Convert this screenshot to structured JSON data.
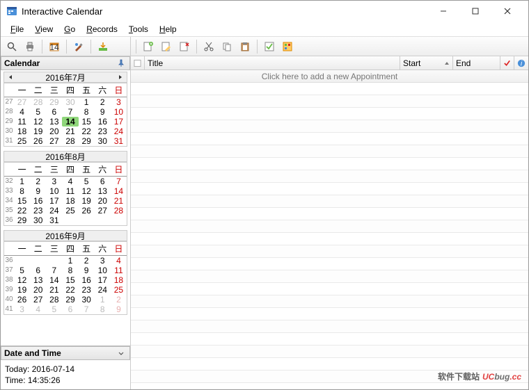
{
  "window": {
    "title": "Interactive Calendar"
  },
  "menu": {
    "file": "File",
    "view": "View",
    "go": "Go",
    "records": "Records",
    "tools": "Tools",
    "help": "Help"
  },
  "sidebar": {
    "calendar_label": "Calendar",
    "datetime_label": "Date and Time",
    "today_label": "Today: 2016-07-14",
    "time_label": "Time: 14:35:26"
  },
  "dow": [
    "一",
    "二",
    "三",
    "四",
    "五",
    "六",
    "日"
  ],
  "months": [
    {
      "title": "2016年7月",
      "nav": true,
      "weeks": [
        {
          "wk": 27,
          "days": [
            {
              "n": 27,
              "o": 1
            },
            {
              "n": 28,
              "o": 1
            },
            {
              "n": 29,
              "o": 1
            },
            {
              "n": 30,
              "o": 1
            },
            {
              "n": 1
            },
            {
              "n": 2
            },
            {
              "n": 3,
              "s": 1
            }
          ]
        },
        {
          "wk": 28,
          "days": [
            {
              "n": 4
            },
            {
              "n": 5
            },
            {
              "n": 6
            },
            {
              "n": 7
            },
            {
              "n": 8
            },
            {
              "n": 9
            },
            {
              "n": 10,
              "s": 1
            }
          ]
        },
        {
          "wk": 29,
          "days": [
            {
              "n": 11
            },
            {
              "n": 12
            },
            {
              "n": 13
            },
            {
              "n": 14,
              "t": 1
            },
            {
              "n": 15
            },
            {
              "n": 16
            },
            {
              "n": 17,
              "s": 1
            }
          ]
        },
        {
          "wk": 30,
          "days": [
            {
              "n": 18
            },
            {
              "n": 19
            },
            {
              "n": 20
            },
            {
              "n": 21
            },
            {
              "n": 22
            },
            {
              "n": 23
            },
            {
              "n": 24,
              "s": 1
            }
          ]
        },
        {
          "wk": 31,
          "days": [
            {
              "n": 25
            },
            {
              "n": 26
            },
            {
              "n": 27
            },
            {
              "n": 28
            },
            {
              "n": 29
            },
            {
              "n": 30
            },
            {
              "n": 31,
              "s": 1
            }
          ]
        }
      ]
    },
    {
      "title": "2016年8月",
      "nav": false,
      "weeks": [
        {
          "wk": 32,
          "days": [
            {
              "n": 1
            },
            {
              "n": 2
            },
            {
              "n": 3
            },
            {
              "n": 4
            },
            {
              "n": 5
            },
            {
              "n": 6
            },
            {
              "n": 7,
              "s": 1
            }
          ]
        },
        {
          "wk": 33,
          "days": [
            {
              "n": 8
            },
            {
              "n": 9
            },
            {
              "n": 10
            },
            {
              "n": 11
            },
            {
              "n": 12
            },
            {
              "n": 13
            },
            {
              "n": 14,
              "s": 1
            }
          ]
        },
        {
          "wk": 34,
          "days": [
            {
              "n": 15
            },
            {
              "n": 16
            },
            {
              "n": 17
            },
            {
              "n": 18
            },
            {
              "n": 19
            },
            {
              "n": 20
            },
            {
              "n": 21,
              "s": 1
            }
          ]
        },
        {
          "wk": 35,
          "days": [
            {
              "n": 22
            },
            {
              "n": 23
            },
            {
              "n": 24
            },
            {
              "n": 25
            },
            {
              "n": 26
            },
            {
              "n": 27
            },
            {
              "n": 28,
              "s": 1
            }
          ]
        },
        {
          "wk": 36,
          "days": [
            {
              "n": 29
            },
            {
              "n": 30
            },
            {
              "n": 31
            },
            {
              "n": "",
              "o": 1
            },
            {
              "n": "",
              "o": 1
            },
            {
              "n": "",
              "o": 1
            },
            {
              "n": "",
              "o": 1
            }
          ]
        }
      ]
    },
    {
      "title": "2016年9月",
      "nav": false,
      "weeks": [
        {
          "wk": 36,
          "days": [
            {
              "n": "",
              "o": 1
            },
            {
              "n": "",
              "o": 1
            },
            {
              "n": "",
              "o": 1
            },
            {
              "n": 1
            },
            {
              "n": 2
            },
            {
              "n": 3
            },
            {
              "n": 4,
              "s": 1
            }
          ]
        },
        {
          "wk": 37,
          "days": [
            {
              "n": 5
            },
            {
              "n": 6
            },
            {
              "n": 7
            },
            {
              "n": 8
            },
            {
              "n": 9
            },
            {
              "n": 10
            },
            {
              "n": 11,
              "s": 1
            }
          ]
        },
        {
          "wk": 38,
          "days": [
            {
              "n": 12
            },
            {
              "n": 13
            },
            {
              "n": 14
            },
            {
              "n": 15
            },
            {
              "n": 16
            },
            {
              "n": 17
            },
            {
              "n": 18,
              "s": 1
            }
          ]
        },
        {
          "wk": 39,
          "days": [
            {
              "n": 19
            },
            {
              "n": 20
            },
            {
              "n": 21
            },
            {
              "n": 22
            },
            {
              "n": 23
            },
            {
              "n": 24
            },
            {
              "n": 25,
              "s": 1
            }
          ]
        },
        {
          "wk": 40,
          "days": [
            {
              "n": 26
            },
            {
              "n": 27
            },
            {
              "n": 28
            },
            {
              "n": 29
            },
            {
              "n": 30
            },
            {
              "n": 1,
              "o": 1
            },
            {
              "n": 2,
              "o": 1,
              "s": 1
            }
          ]
        },
        {
          "wk": 41,
          "days": [
            {
              "n": 3,
              "o": 1
            },
            {
              "n": 4,
              "o": 1
            },
            {
              "n": 5,
              "o": 1
            },
            {
              "n": 6,
              "o": 1
            },
            {
              "n": 7,
              "o": 1
            },
            {
              "n": 8,
              "o": 1
            },
            {
              "n": 9,
              "o": 1,
              "s": 1
            }
          ]
        }
      ]
    }
  ],
  "columns": {
    "title": "Title",
    "start": "Start",
    "end": "End"
  },
  "list": {
    "add_prompt": "Click here to add a new Appointment"
  },
  "watermark": {
    "brand_a": "UC",
    "brand_b": "bug",
    "brand_c": ".cc",
    "tag": "软件下载站"
  }
}
